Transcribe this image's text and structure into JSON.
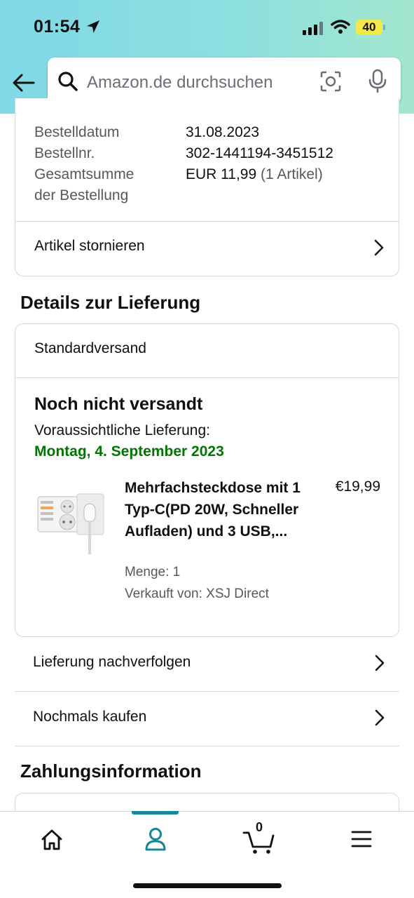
{
  "status_bar": {
    "time": "01:54",
    "battery": "40"
  },
  "search": {
    "placeholder": "Amazon.de durchsuchen"
  },
  "order": {
    "rows": [
      {
        "label": "Bestelldatum",
        "value": "31.08.2023"
      },
      {
        "label": "Bestellnr.",
        "value": "302-1441194-3451512"
      }
    ],
    "total_label_1": "Gesamtsumme",
    "total_label_2": "der Bestellung",
    "total_value": "EUR 11,99",
    "total_count": "(1 Artikel)",
    "cancel_label": "Artikel stornieren"
  },
  "delivery": {
    "section_title": "Details zur Lieferung",
    "method": "Standardversand",
    "status_title": "Noch nicht versandt",
    "eta_label": "Voraussichtliche Lieferung:",
    "eta_date": "Montag, 4. September 2023",
    "product": {
      "title": "Mehrfachsteckdose mit 1 Typ-C(PD 20W, Schneller Aufladen) und 3 USB,...",
      "price": "€19,99",
      "quantity": "Menge: 1",
      "seller": "Verkauft von: XSJ Direct"
    },
    "track_label": "Lieferung nachverfolgen",
    "buy_again_label": "Nochmals kaufen"
  },
  "payment": {
    "section_title": "Zahlungsinformation"
  },
  "bottom_nav": {
    "cart_count": "0",
    "active_index": 1
  },
  "colors": {
    "accent": "#148895",
    "delivery_green": "#007600",
    "border": "#d5d9d9"
  }
}
